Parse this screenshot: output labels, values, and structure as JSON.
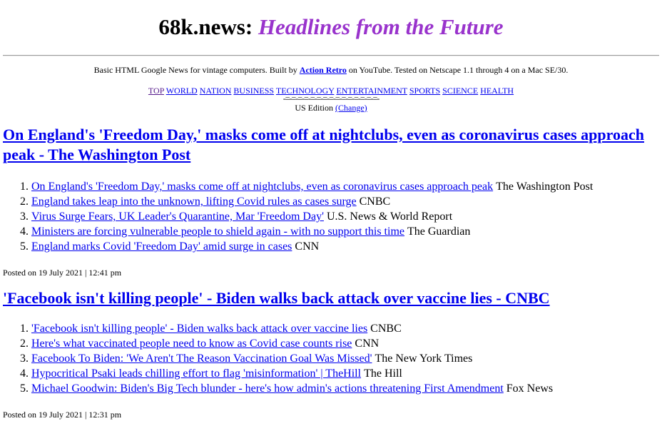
{
  "site": {
    "name": "68k.news:",
    "tagline": "Headlines from the Future",
    "intro_prefix": "Basic HTML Google News for vintage computers. Built by ",
    "intro_link": "Action Retro",
    "intro_suffix": " on YouTube. Tested on Netscape 1.1 through 4 on a Mac SE/30."
  },
  "nav": {
    "items": [
      "TOP",
      "WORLD",
      "NATION",
      "BUSINESS",
      "TECHNOLOGY",
      "ENTERTAINMENT",
      "SPORTS",
      "SCIENCE",
      "HEALTH"
    ],
    "underline": "-=-=-=-=-=-=-=-=-=-=-=-=-=-=-=-",
    "edition_label": "US Edition",
    "change_link": "(Change)"
  },
  "stories": [
    {
      "headline": "On England's 'Freedom Day,' masks come off at nightclubs, even as coronavirus cases approach peak - The Washington Post",
      "items": [
        {
          "title": "On England's 'Freedom Day,' masks come off at nightclubs, even as coronavirus cases approach peak",
          "source": "The Washington Post"
        },
        {
          "title": "England takes leap into the unknown, lifting Covid rules as cases surge",
          "source": "CNBC"
        },
        {
          "title": "Virus Surge Fears, UK Leader's Quarantine, Mar 'Freedom Day'",
          "source": "U.S. News & World Report"
        },
        {
          "title": "Ministers are forcing vulnerable people to shield again - with no support this time",
          "source": "The Guardian"
        },
        {
          "title": "England marks Covid 'Freedom Day' amid surge in cases",
          "source": "CNN"
        }
      ],
      "posted": "Posted on 19 July 2021 | 12:41 pm"
    },
    {
      "headline": "'Facebook isn't killing people' - Biden walks back attack over vaccine lies - CNBC",
      "items": [
        {
          "title": "'Facebook isn't killing people' - Biden walks back attack over vaccine lies",
          "source": "CNBC"
        },
        {
          "title": "Here's what vaccinated people need to know as Covid case counts rise",
          "source": "CNN"
        },
        {
          "title": "Facebook To Biden: 'We Aren't The Reason Vaccination Goal Was Missed'",
          "source": "The New York Times"
        },
        {
          "title": "Hypocritical Psaki leads chilling effort to flag 'misinformation' | TheHill",
          "source": "The Hill"
        },
        {
          "title": "Michael Goodwin: Biden's Big Tech blunder - here's how admin's actions threatening First Amendment",
          "source": "Fox News"
        }
      ],
      "posted": "Posted on 19 July 2021 | 12:31 pm"
    }
  ]
}
